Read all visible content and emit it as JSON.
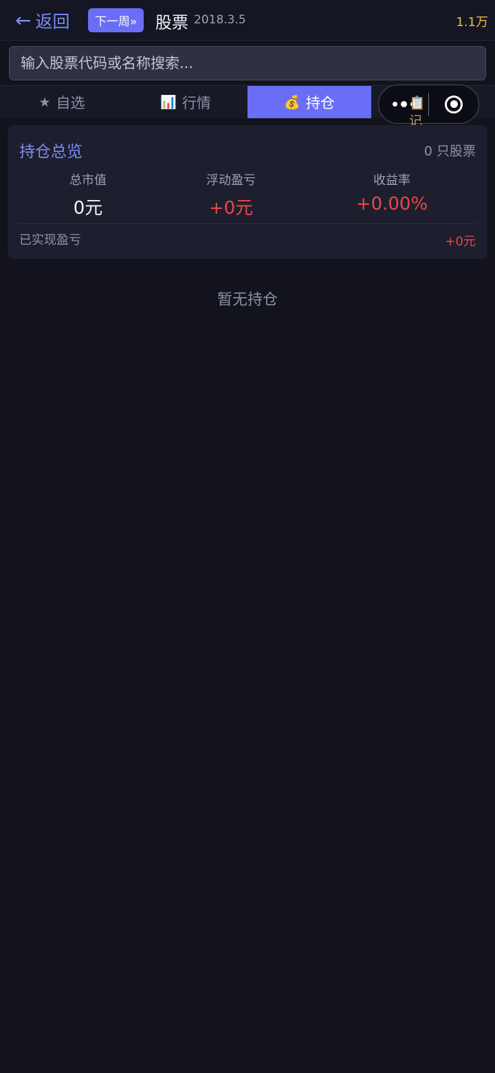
{
  "header": {
    "back_arrow": "←",
    "back_label": "返回",
    "next_week_label": "下一周»",
    "title": "股票",
    "date": "2018.3.5",
    "balance": "1.1万"
  },
  "search": {
    "placeholder": "输入股票代码或名称搜索..."
  },
  "tabs": [
    {
      "icon": "★",
      "label": "自选",
      "active": false
    },
    {
      "icon": "📊",
      "label": "行情",
      "active": false
    },
    {
      "icon": "💰",
      "label": "持仓",
      "active": true
    },
    {
      "icon": "📋",
      "label": "记",
      "active": false
    }
  ],
  "overview": {
    "title": "持仓总览",
    "stock_count": "0 只股票",
    "metrics": [
      {
        "label": "总市值",
        "value": "0元"
      },
      {
        "label": "浮动盈亏",
        "value": "+0元"
      },
      {
        "label": "收益率",
        "value": "+0.00%"
      }
    ],
    "realized_label": "已实现盈亏",
    "realized_value": "+0元"
  },
  "empty_state": {
    "text": "暂无持仓"
  },
  "colors": {
    "background": "#12131c",
    "accent": "#6a6ef6",
    "link": "#7b8cf3",
    "gain": "#ee4545",
    "balance": "#f5b93a"
  }
}
